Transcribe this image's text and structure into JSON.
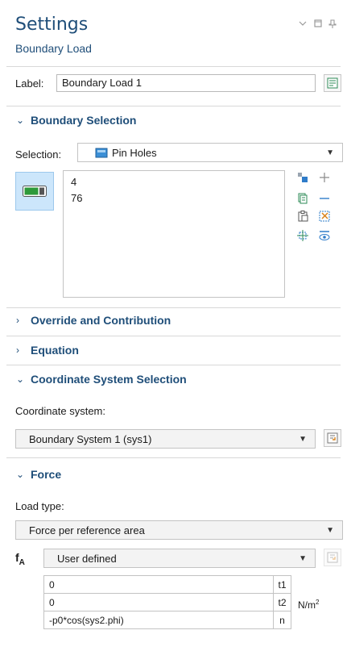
{
  "header": {
    "title": "Settings",
    "subtitle": "Boundary Load",
    "controls": [
      "chevron-down-icon",
      "maximize-icon",
      "pin-icon"
    ]
  },
  "label_row": {
    "label": "Label:",
    "value": "Boundary Load 1"
  },
  "boundary_selection": {
    "title": "Boundary Selection",
    "selection_label": "Selection:",
    "selection_value": "Pin Holes",
    "entities": [
      "4",
      "76"
    ]
  },
  "override": {
    "title": "Override and Contribution"
  },
  "equation": {
    "title": "Equation"
  },
  "coord_selection": {
    "title": "Coordinate System Selection",
    "coord_label": "Coordinate system:",
    "coord_value": "Boundary System 1 (sys1)"
  },
  "force": {
    "title": "Force",
    "load_type_label": "Load type:",
    "load_type_value": "Force per reference area",
    "f_symbol": "f",
    "f_subscript": "A",
    "f_mode": "User defined",
    "components": [
      {
        "value": "0",
        "name": "t1"
      },
      {
        "value": "0",
        "name": "t2"
      },
      {
        "value": "-p0*cos(sys2.phi)",
        "name": "n"
      }
    ],
    "unit": "N/m",
    "unit_sup": "2"
  },
  "colors": {
    "accent": "#1f4e79",
    "toggle_bg": "#cce6fb",
    "toggle_green": "#2e9a3a"
  }
}
